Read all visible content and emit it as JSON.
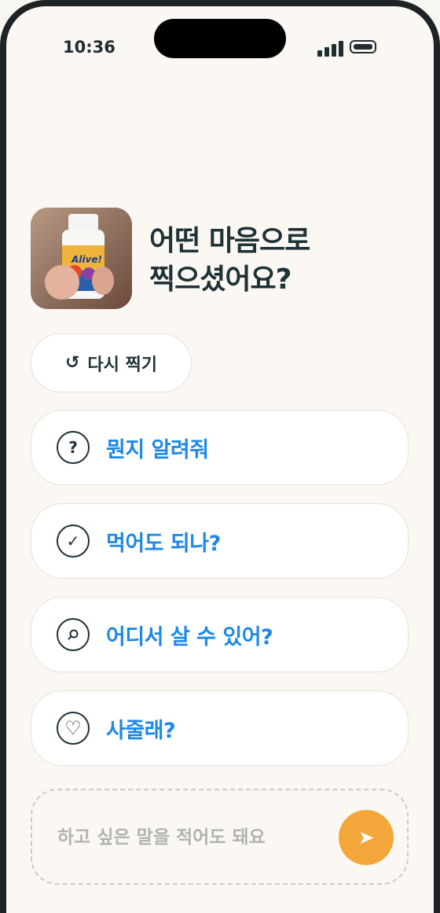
{
  "status_bar": {
    "time": "10:36",
    "signal_icon": "signal-icon",
    "battery_icon": "battery-icon"
  },
  "header": {
    "title_line1": "어떤 마음으로",
    "title_line2": "찍으셨어요?"
  },
  "photo": {
    "label": "Alive!"
  },
  "retake": {
    "label": "다시 찍기",
    "icon": "↺"
  },
  "options": [
    {
      "label": "뭔지 알려줘",
      "icon": "question-icon",
      "glyph": "?"
    },
    {
      "label": "먹어도 되나?",
      "icon": "check-icon",
      "glyph": "✓"
    },
    {
      "label": "어디서 살 수 있어?",
      "icon": "search-icon",
      "glyph": ""
    },
    {
      "label": "사줄래?",
      "icon": "heart-icon",
      "glyph": "♡"
    }
  ],
  "composer": {
    "placeholder": "하고 싶은 말을 적어도 돼요",
    "send_icon": "➤"
  },
  "colors": {
    "accent_blue": "#1d88e8",
    "send_orange": "#f3a63a",
    "text_dark": "#1f3238",
    "background": "#fbf8f3"
  }
}
